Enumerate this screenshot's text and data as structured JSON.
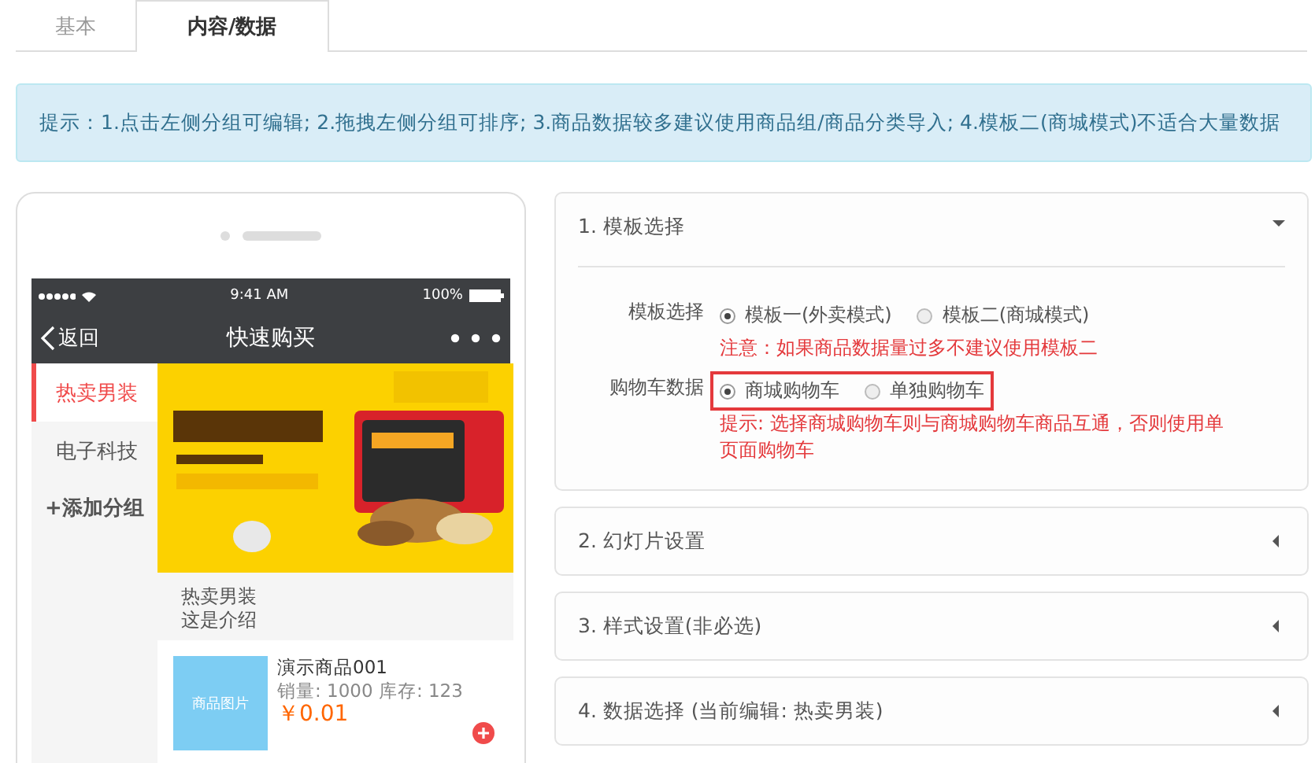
{
  "tabs": [
    {
      "label": "基本",
      "selected": false
    },
    {
      "label": "内容/数据",
      "selected": true
    }
  ],
  "alert": "提示：1.点击左侧分组可编辑; 2.拖拽左侧分组可排序; 3.商品数据较多建议使用商品组/商品分类导入; 4.模板二(商城模式)不适合大量数据",
  "phone": {
    "status_bar": {
      "time": "9:41 AM",
      "battery": "100%"
    },
    "nav": {
      "back": "返回",
      "title": "快速购买"
    },
    "categories": [
      {
        "label": "热卖男装",
        "selected": true
      },
      {
        "label": "电子科技",
        "selected": false
      }
    ],
    "add_group": "+添加分组",
    "group": {
      "title": "热卖男装",
      "description": "这是介绍"
    },
    "products": [
      {
        "image_label": "商品图片",
        "name": "演示商品001",
        "meta": "销量: 1000 库存: 123",
        "price": "￥0.01"
      }
    ]
  },
  "panels": [
    {
      "title": "1. 模板选择",
      "expanded": true,
      "fields": [
        {
          "label": "模板选择",
          "highlighted": false,
          "options": [
            {
              "label": "模板一(外卖模式)",
              "selected": true
            },
            {
              "label": "模板二(商城模式)",
              "selected": false
            }
          ],
          "note": "注意：如果商品数据量过多不建议使用模板二"
        },
        {
          "label": "购物车数据",
          "highlighted": true,
          "options": [
            {
              "label": "商城购物车",
              "selected": true
            },
            {
              "label": "单独购物车",
              "selected": false
            }
          ],
          "note": "提示: 选择商城购物车则与商城购物车商品互通，否则使用单页面购物车"
        }
      ]
    },
    {
      "title": "2. 幻灯片设置",
      "expanded": false
    },
    {
      "title": "3. 样式设置(非必选)",
      "expanded": false
    },
    {
      "title": "4. 数据选择 (当前编辑: 热卖男装)",
      "expanded": false
    }
  ]
}
